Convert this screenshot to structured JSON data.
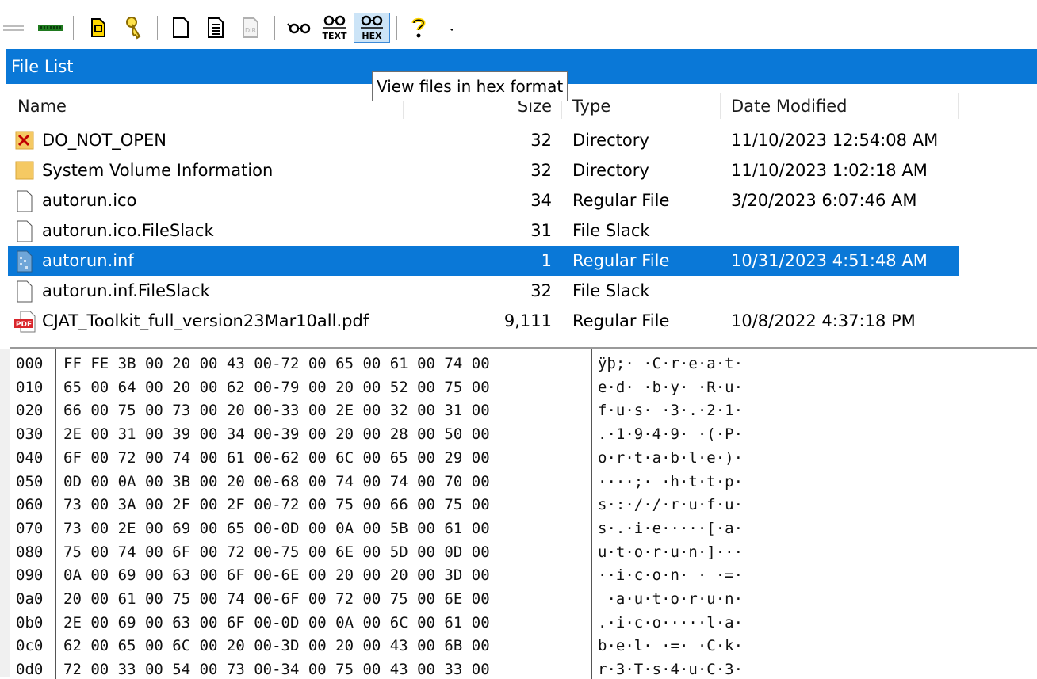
{
  "toolbar": {
    "buttons": [
      {
        "name": "back-icon"
      },
      {
        "name": "drive-icon"
      },
      {
        "name": "evidence-icon"
      },
      {
        "name": "key-icon"
      },
      {
        "name": "new-file-icon"
      },
      {
        "name": "properties-icon"
      },
      {
        "name": "dir-icon"
      },
      {
        "name": "view-glasses-icon"
      },
      {
        "name": "view-text-icon",
        "label": "TEXT"
      },
      {
        "name": "view-hex-icon",
        "label": "HEX"
      },
      {
        "name": "help-icon"
      },
      {
        "name": "dropdown-arrow-icon"
      }
    ]
  },
  "panel": {
    "title": "File List",
    "tooltip": "View files in hex format"
  },
  "columns": {
    "name": "Name",
    "size": "Size",
    "type": "Type",
    "date": "Date Modified"
  },
  "files": [
    {
      "icon": "deleted-folder-icon",
      "name": "DO_NOT_OPEN",
      "size": "32",
      "type": "Directory",
      "date": "11/10/2023 12:54:08 AM"
    },
    {
      "icon": "folder-icon",
      "name": "System Volume Information",
      "size": "32",
      "type": "Directory",
      "date": "11/10/2023 1:02:18 AM"
    },
    {
      "icon": "file-icon",
      "name": "autorun.ico",
      "size": "34",
      "type": "Regular File",
      "date": "3/20/2023 6:07:46 AM"
    },
    {
      "icon": "file-icon",
      "name": "autorun.ico.FileSlack",
      "size": "31",
      "type": "File Slack",
      "date": ""
    },
    {
      "icon": "settings-file-icon",
      "name": "autorun.inf",
      "size": "1",
      "type": "Regular File",
      "date": "10/31/2023 4:51:48 AM",
      "selected": true
    },
    {
      "icon": "file-icon",
      "name": "autorun.inf.FileSlack",
      "size": "32",
      "type": "File Slack",
      "date": ""
    },
    {
      "icon": "pdf-icon",
      "name": "CJAT_Toolkit_full_version23Mar10all.pdf",
      "size": "9,111",
      "type": "Regular File",
      "date": "10/8/2022 4:37:18 PM"
    }
  ],
  "hex": [
    {
      "off": "000",
      "bytes": "FF FE 3B 00 20 00 43 00-72 00 65 00 61 00 74 00",
      "ascii": "ÿþ;· ·C·r·e·a·t·"
    },
    {
      "off": "010",
      "bytes": "65 00 64 00 20 00 62 00-79 00 20 00 52 00 75 00",
      "ascii": "e·d· ·b·y· ·R·u·"
    },
    {
      "off": "020",
      "bytes": "66 00 75 00 73 00 20 00-33 00 2E 00 32 00 31 00",
      "ascii": "f·u·s· ·3·.·2·1·"
    },
    {
      "off": "030",
      "bytes": "2E 00 31 00 39 00 34 00-39 00 20 00 28 00 50 00",
      "ascii": ".·1·9·4·9· ·(·P·"
    },
    {
      "off": "040",
      "bytes": "6F 00 72 00 74 00 61 00-62 00 6C 00 65 00 29 00",
      "ascii": "o·r·t·a·b·l·e·)·"
    },
    {
      "off": "050",
      "bytes": "0D 00 0A 00 3B 00 20 00-68 00 74 00 74 00 70 00",
      "ascii": "····;· ·h·t·t·p·"
    },
    {
      "off": "060",
      "bytes": "73 00 3A 00 2F 00 2F 00-72 00 75 00 66 00 75 00",
      "ascii": "s·:·/·/·r·u·f·u·"
    },
    {
      "off": "070",
      "bytes": "73 00 2E 00 69 00 65 00-0D 00 0A 00 5B 00 61 00",
      "ascii": "s·.·i·e·····[·a·"
    },
    {
      "off": "080",
      "bytes": "75 00 74 00 6F 00 72 00-75 00 6E 00 5D 00 0D 00",
      "ascii": "u·t·o·r·u·n·]···"
    },
    {
      "off": "090",
      "bytes": "0A 00 69 00 63 00 6F 00-6E 00 20 00 20 00 3D 00",
      "ascii": "··i·c·o·n· · ·=·"
    },
    {
      "off": "0a0",
      "bytes": "20 00 61 00 75 00 74 00-6F 00 72 00 75 00 6E 00",
      "ascii": " ·a·u·t·o·r·u·n·"
    },
    {
      "off": "0b0",
      "bytes": "2E 00 69 00 63 00 6F 00-0D 00 0A 00 6C 00 61 00",
      "ascii": ".·i·c·o·····l·a·"
    },
    {
      "off": "0c0",
      "bytes": "62 00 65 00 6C 00 20 00-3D 00 20 00 43 00 6B 00",
      "ascii": "b·e·l· ·=· ·C·k·"
    },
    {
      "off": "0d0",
      "bytes": "72 00 33 00 54 00 73 00-34 00 75 00 43 00 33 00",
      "ascii": "r·3·T·s·4·u·C·3·"
    }
  ],
  "colors": {
    "accent": "#0a78d7",
    "selection_text": "#ffffff"
  }
}
